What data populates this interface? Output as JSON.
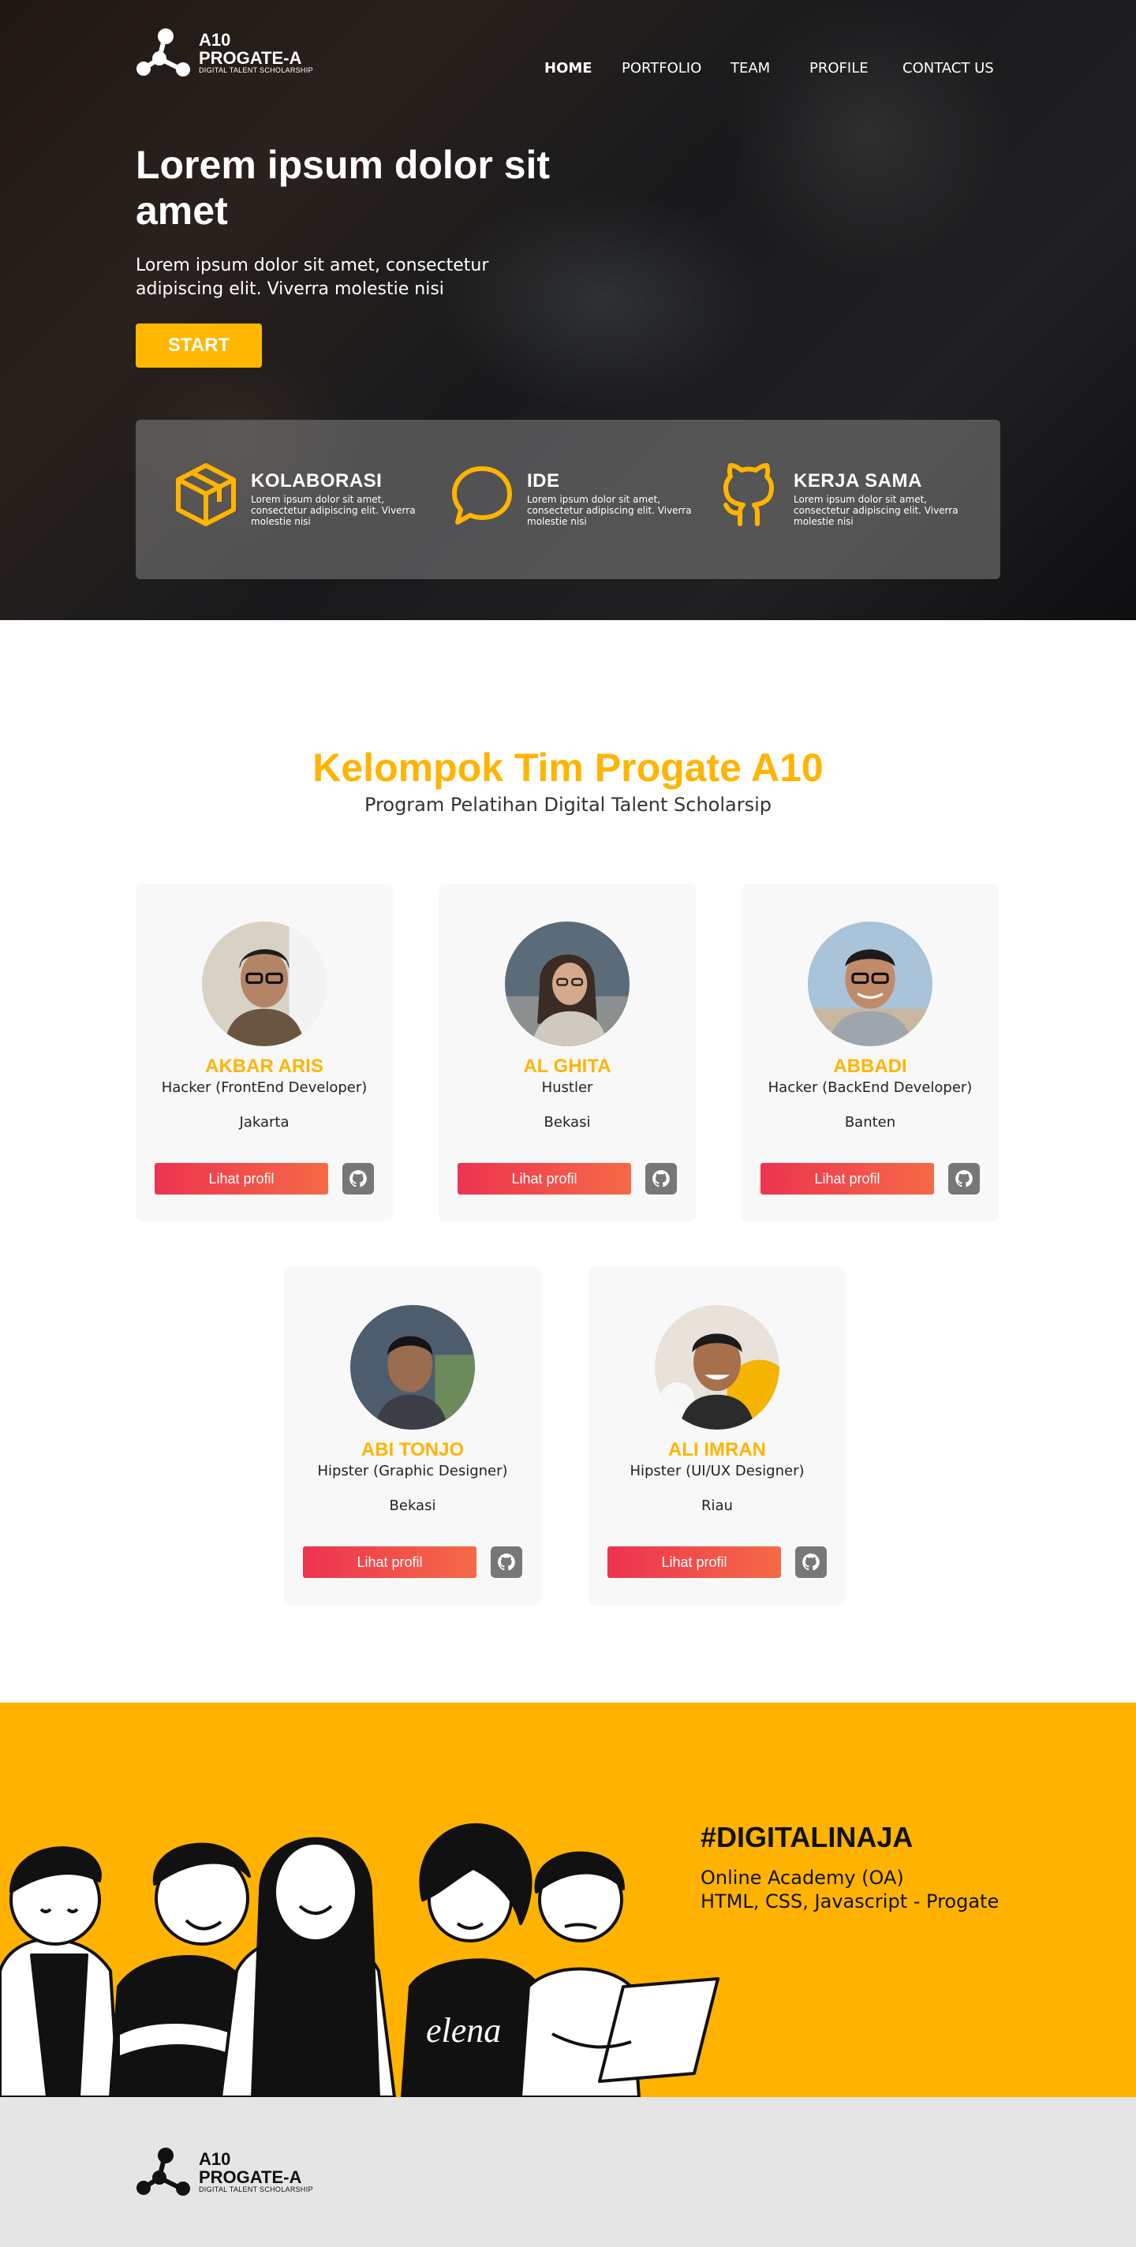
{
  "brand": {
    "line1": "A10",
    "line2": "PROGATE-A",
    "line3": "DIGITAL TALENT SCHOLARSHIP"
  },
  "nav": {
    "items": [
      {
        "label": "HOME",
        "active": true
      },
      {
        "label": "PORTFOLIO",
        "active": false
      },
      {
        "label": "TEAM",
        "active": false
      },
      {
        "label": "PROFILE",
        "active": false
      },
      {
        "label": "CONTACT US",
        "active": false
      }
    ]
  },
  "hero": {
    "title": "Lorem ipsum dolor sit amet",
    "subtitle": "Lorem ipsum dolor sit amet, consectetur adipiscing elit. Viverra molestie nisi",
    "button": "START",
    "features": [
      {
        "icon": "cube-icon",
        "title": "KOLABORASI",
        "desc": "Lorem ipsum dolor sit amet, consectetur adipiscing elit. Viverra molestie nisi"
      },
      {
        "icon": "chat-bubble-icon",
        "title": "IDE",
        "desc": "Lorem ipsum dolor sit amet, consectetur adipiscing elit. Viverra molestie nisi"
      },
      {
        "icon": "github-icon",
        "title": "KERJA SAMA",
        "desc": "Lorem ipsum dolor sit amet, consectetur adipiscing elit. Viverra molestie nisi"
      }
    ]
  },
  "team": {
    "title": "Kelompok Tim Progate A10",
    "subtitle": "Program Pelatihan Digital Talent Scholarsip",
    "button_label": "Lihat profil",
    "members": [
      {
        "name": "AKBAR ARIS",
        "role": "Hacker (FrontEnd Developer)",
        "city": "Jakarta"
      },
      {
        "name": "AL GHITA",
        "role": "Hustler",
        "city": "Bekasi"
      },
      {
        "name": "ABBADI",
        "role": "Hacker (BackEnd Developer)",
        "city": "Banten"
      },
      {
        "name": "ABI TONJO",
        "role": "Hipster (Graphic Designer)",
        "city": "Bekasi"
      },
      {
        "name": "ALI IMRAN",
        "role": "Hipster (UI/UX Designer)",
        "city": "Riau"
      }
    ]
  },
  "digital": {
    "title": "#DIGITALINAJA",
    "line1": "Online Academy (OA)",
    "line2": "HTML, CSS, Javascript - Progate"
  },
  "colors": {
    "accent": "#FFB400",
    "button_gradient_start": "#EC3350",
    "button_gradient_end": "#F56A46",
    "footer_bg": "#E5E5E5"
  }
}
